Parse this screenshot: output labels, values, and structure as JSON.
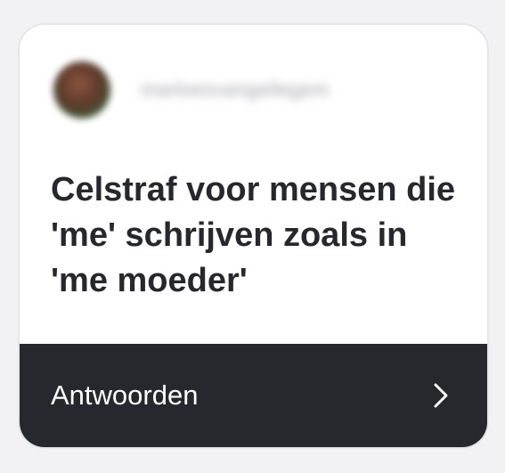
{
  "post": {
    "username": "marloesvangellegem",
    "question": "Celstraf voor mensen die 'me' schrijven zoals in 'me moeder'"
  },
  "footer": {
    "reply_label": "Antwoorden",
    "icon": "chevron-right-icon"
  },
  "colors": {
    "card_background": "#ffffff",
    "footer_background": "#26282d",
    "question_text": "#27282d"
  }
}
